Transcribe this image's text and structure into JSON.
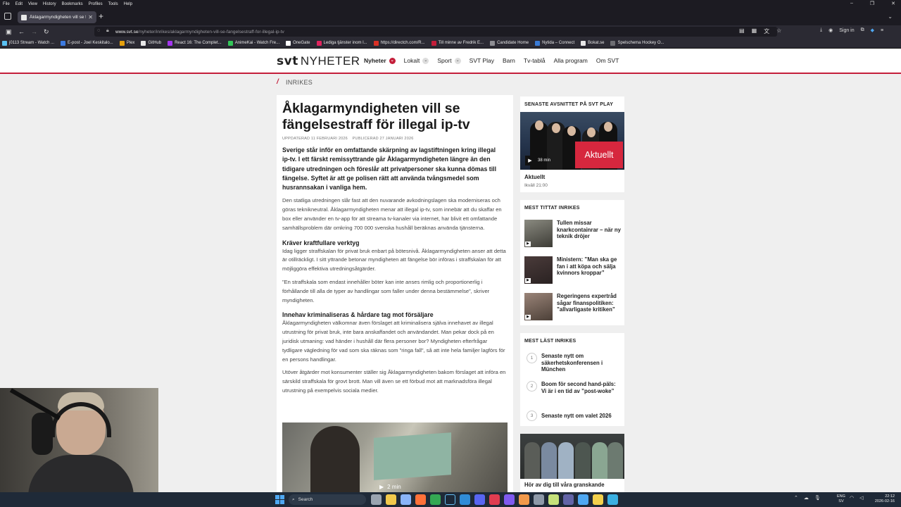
{
  "browser": {
    "menu": [
      "File",
      "Edit",
      "View",
      "History",
      "Bookmarks",
      "Profiles",
      "Tools",
      "Help"
    ],
    "tab_title": "Åklagarmyndigheten vill se fäng",
    "url_host": "www.svt.se",
    "url_path": "/nyheter/inrikes/aklagarmyndigheten-vill-se-fangelsestraff-for-illegal-ip-tv",
    "sign_in": "Sign in",
    "bookmarks": [
      {
        "label": "j0113 Stream - Watch ...",
        "color": "#59c1f2"
      },
      {
        "label": "E-post - Joel Keskitalo...",
        "color": "#3d7be0"
      },
      {
        "label": "Plex",
        "color": "#e5a00d"
      },
      {
        "label": "GitHub",
        "color": "#e8e8e8"
      },
      {
        "label": "React 16: The Complet...",
        "color": "#a435f0"
      },
      {
        "label": "AnimeKai - Watch Fre...",
        "color": "#34c759"
      },
      {
        "label": "OneGate",
        "color": "#ffffff"
      },
      {
        "label": "Lediga tjänster inom l...",
        "color": "#e0245e"
      },
      {
        "label": "https://directch.com/R...",
        "color": "#d93025"
      },
      {
        "label": "Till minne av Fredrik E...",
        "color": "#c41e3a"
      },
      {
        "label": "Candidate Home",
        "color": "#8e8e93"
      },
      {
        "label": "Nytida – Connect",
        "color": "#3a7bd5"
      },
      {
        "label": "Bokat.se",
        "color": "#e8e8e8"
      },
      {
        "label": "Spelschema Hockey O...",
        "color": "#6d6d72"
      }
    ]
  },
  "site": {
    "logo_svt": "svt",
    "logo_nyheter": "NYHETER",
    "nav": [
      {
        "label": "Nyheter",
        "dropdown": "red",
        "active": true
      },
      {
        "label": "Lokalt",
        "dropdown": "grey",
        "active": false
      },
      {
        "label": "Sport",
        "dropdown": "grey",
        "active": false
      },
      {
        "label": "SVT Play",
        "dropdown": "",
        "active": false
      },
      {
        "label": "Barn",
        "dropdown": "",
        "active": false
      },
      {
        "label": "Tv-tablå",
        "dropdown": "",
        "active": false
      },
      {
        "label": "Alla program",
        "dropdown": "",
        "active": false
      },
      {
        "label": "Om SVT",
        "dropdown": "",
        "active": false
      }
    ],
    "section": "INRIKES"
  },
  "article": {
    "headline": "Åklagarmyndigheten vill se fängelsestraff för illegal ip-tv",
    "updated": "UPPDATERAD 11 FEBRUARI 2026",
    "published": "PUBLICERAD 27 JANUARI 2026",
    "lead": "Sverige står inför en omfattande skärpning av lagstiftningen kring illegal ip-tv. I ett färskt remissyttrande går Åklagarmyndigheten längre än den tidigare utredningen och föreslår att privatpersoner ska kunna dömas till fängelse. Syftet är att ge polisen rätt att använda tvångsmedel som husrannsakan i vanliga hem.",
    "p1": "Den statliga utredningen slår fast att den nuvarande avkodningslagen ska moderniseras och göras teknikneutral. Åklagarmyndigheten menar att illegal ip-tv, som innebär att du skaffar en box eller använder en tv-app för att streama tv-kanaler via internet, har blivit ett omfattande samhällsproblem där omkring 700 000 svenska hushåll beräknas använda tjänsterna.",
    "h1": "Kräver kraftfullare verktyg",
    "p2": "Idag ligger straffskalan för privat bruk enbart på bötesnivå. Åklagarmyndigheten anser att detta är otillräckligt. I sitt yttrande betonar myndigheten att fängelse bör införas i straffskalan för att möjliggöra effektiva utredningsåtgärder.",
    "p3": "”En straffskala som endast innehåller böter kan inte anses rimlig och proportionerlig i förhållande till alla de typer av handlingar som faller under denna bestämmelse”, skriver myndigheten.",
    "h2": "Innehav kriminaliseras & hårdare tag mot försäljare",
    "p4": "Åklagarmyndigheten välkomnar även förslaget att kriminalisera själva innehavet av illegal utrustning för privat bruk, inte bara anskaffandet och användandet. Man pekar dock på en juridisk utmaning: vad händer i hushåll där flera personer bor? Myndigheten efterfrågar tydligare vägledning för vad som ska räknas som ”ringa fall”, så att inte hela familjer lagförs för en persons handlingar.",
    "p5": "Utöver åtgärder mot konsumenter ställer sig Åklagarmyndigheten bakom förslaget att införa en särskild straffskala för grovt brott. Man vill även se ett förbud mot att marknadsföra illegal utrustning på exempelvis sociala medier.",
    "video_duration": "2 min"
  },
  "sidebar": {
    "play_head": "SENASTE AVSNITTET PÅ SVT PLAY",
    "play_badge": "Aktuellt",
    "play_duration": "38 min",
    "play_show": "Aktuellt",
    "play_time": "Ikväll 21:00",
    "most_viewed_head": "MEST TITTAT INRIKES",
    "most_viewed": [
      "Tullen missar knarkcontainrar – när ny teknik dröjer",
      "Ministern: ”Man ska ge fan i att köpa och sälja kvinnors kroppar”",
      "Regeringens expertråd sågar finanspolitiken: ”allvarligaste kritiken”"
    ],
    "most_read_head": "MEST LÄST INRIKES",
    "most_read": [
      {
        "num": "1",
        "title": "Senaste nytt om säkerhetskonferensen i München"
      },
      {
        "num": "2",
        "title": "Boom för second hand-päls: Vi är i en tid av ”post-woke”"
      },
      {
        "num": "3",
        "title": "Senaste nytt om valet 2026"
      }
    ],
    "promo_text": "Hör av dig till våra granskande"
  },
  "taskbar": {
    "search": "Search",
    "lang1": "ENG",
    "lang2": "SV",
    "time": "22:12",
    "date": "2026-02-16"
  }
}
